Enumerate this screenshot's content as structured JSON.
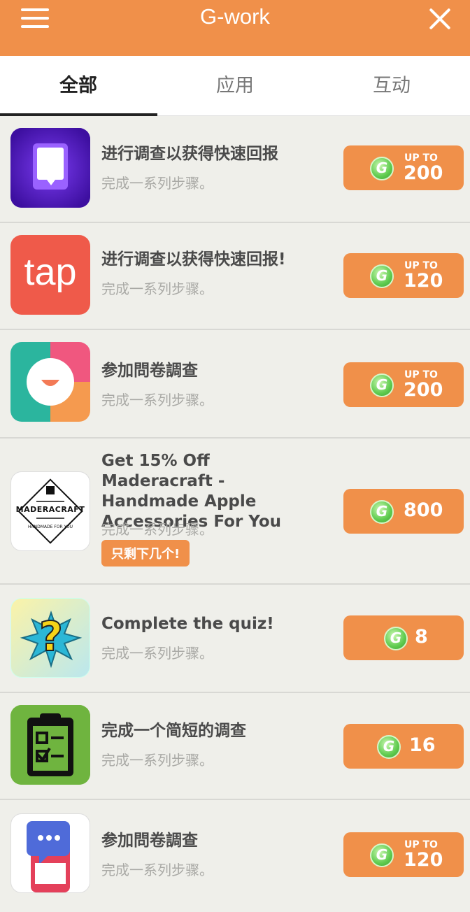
{
  "header": {
    "title": "G-work"
  },
  "tabs": [
    {
      "label": "全部"
    },
    {
      "label": "应用"
    },
    {
      "label": "互动"
    }
  ],
  "offers": [
    {
      "title": "进行调查以获得快速回报",
      "subtitle": "完成一系列步骤。",
      "reward_prefix": "UP TO",
      "reward": "200"
    },
    {
      "title": "进行调查以获得快速回报!",
      "subtitle": "完成一系列步骤。",
      "reward_prefix": "UP TO",
      "reward": "120",
      "icon_text": "tap"
    },
    {
      "title": "参加問卷調查",
      "subtitle": "完成一系列步骤。",
      "reward_prefix": "UP TO",
      "reward": "200"
    },
    {
      "title": "Get 15% Off Maderacraft - Handmade Apple Accessories For You",
      "subtitle": "完成一系列步骤。",
      "badge": "只剩下几个!",
      "reward": "800",
      "icon_text": "MADERACRAFT",
      "icon_subtext": "HANDMADE FOR YOU"
    },
    {
      "title": "Complete the quiz!",
      "subtitle": "完成一系列步骤。",
      "reward": "8"
    },
    {
      "title": "完成一个简短的调查",
      "subtitle": "完成一系列步骤。",
      "reward": "16"
    },
    {
      "title": "参加問卷調查",
      "subtitle": "完成一系列步骤。",
      "reward_prefix": "UP TO",
      "reward": "120"
    }
  ],
  "coin_letter": "G",
  "colors": {
    "accent": "#f0904a",
    "coin": "#5ecb4e",
    "background": "#efefea"
  }
}
